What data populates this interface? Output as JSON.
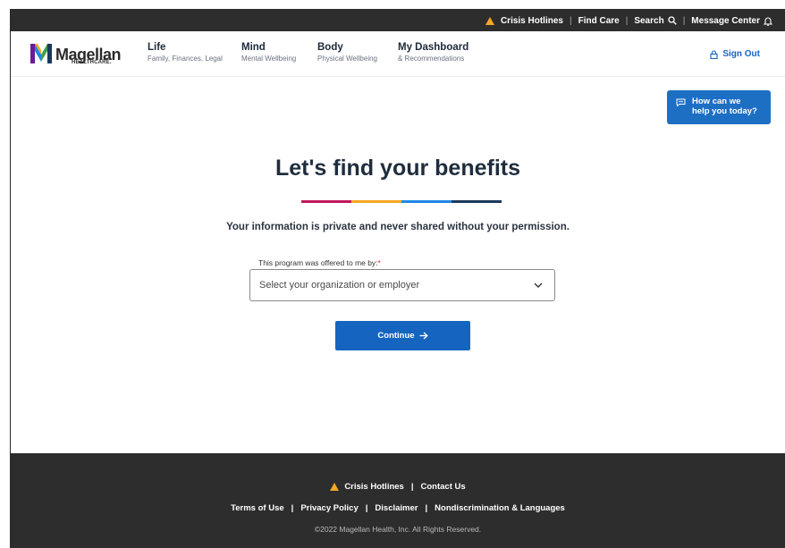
{
  "utility_bar": {
    "crisis": "Crisis Hotlines",
    "find_care": "Find Care",
    "search": "Search",
    "message_center": "Message Center"
  },
  "logo": {
    "brand": "Magellan",
    "sub": "HEALTHCARE."
  },
  "nav": [
    {
      "title": "Life",
      "sub": "Family, Finances, Legal"
    },
    {
      "title": "Mind",
      "sub": "Mental Wellbeing"
    },
    {
      "title": "Body",
      "sub": "Physical Wellbeing"
    },
    {
      "title": "My Dashboard",
      "sub": "& Recommendations"
    }
  ],
  "sign_out": "Sign Out",
  "help": {
    "line1": "How can we",
    "line2": "help you today?"
  },
  "main": {
    "title": "Let's find your benefits",
    "subtitle": "Your information is private and never shared without your permission.",
    "field_label": "This program was offered to me by:",
    "required_mark": "*",
    "select_placeholder": "Select your organization or employer",
    "continue_label": "Continue"
  },
  "stripe_colors": [
    "#c2185b",
    "#f5a623",
    "#1e88e5",
    "#1a3a5c"
  ],
  "footer": {
    "crisis": "Crisis Hotlines",
    "contact": "Contact Us",
    "links": [
      "Terms of Use",
      "Privacy Policy",
      "Disclaimer",
      "Nondiscrimination & Languages"
    ],
    "copyright": "©2022 Magellan Health, Inc. All Rights Reserved."
  },
  "colors": {
    "accent": "#1565c0",
    "warning": "#f5a623",
    "dark_bar": "#2d2d2d"
  }
}
